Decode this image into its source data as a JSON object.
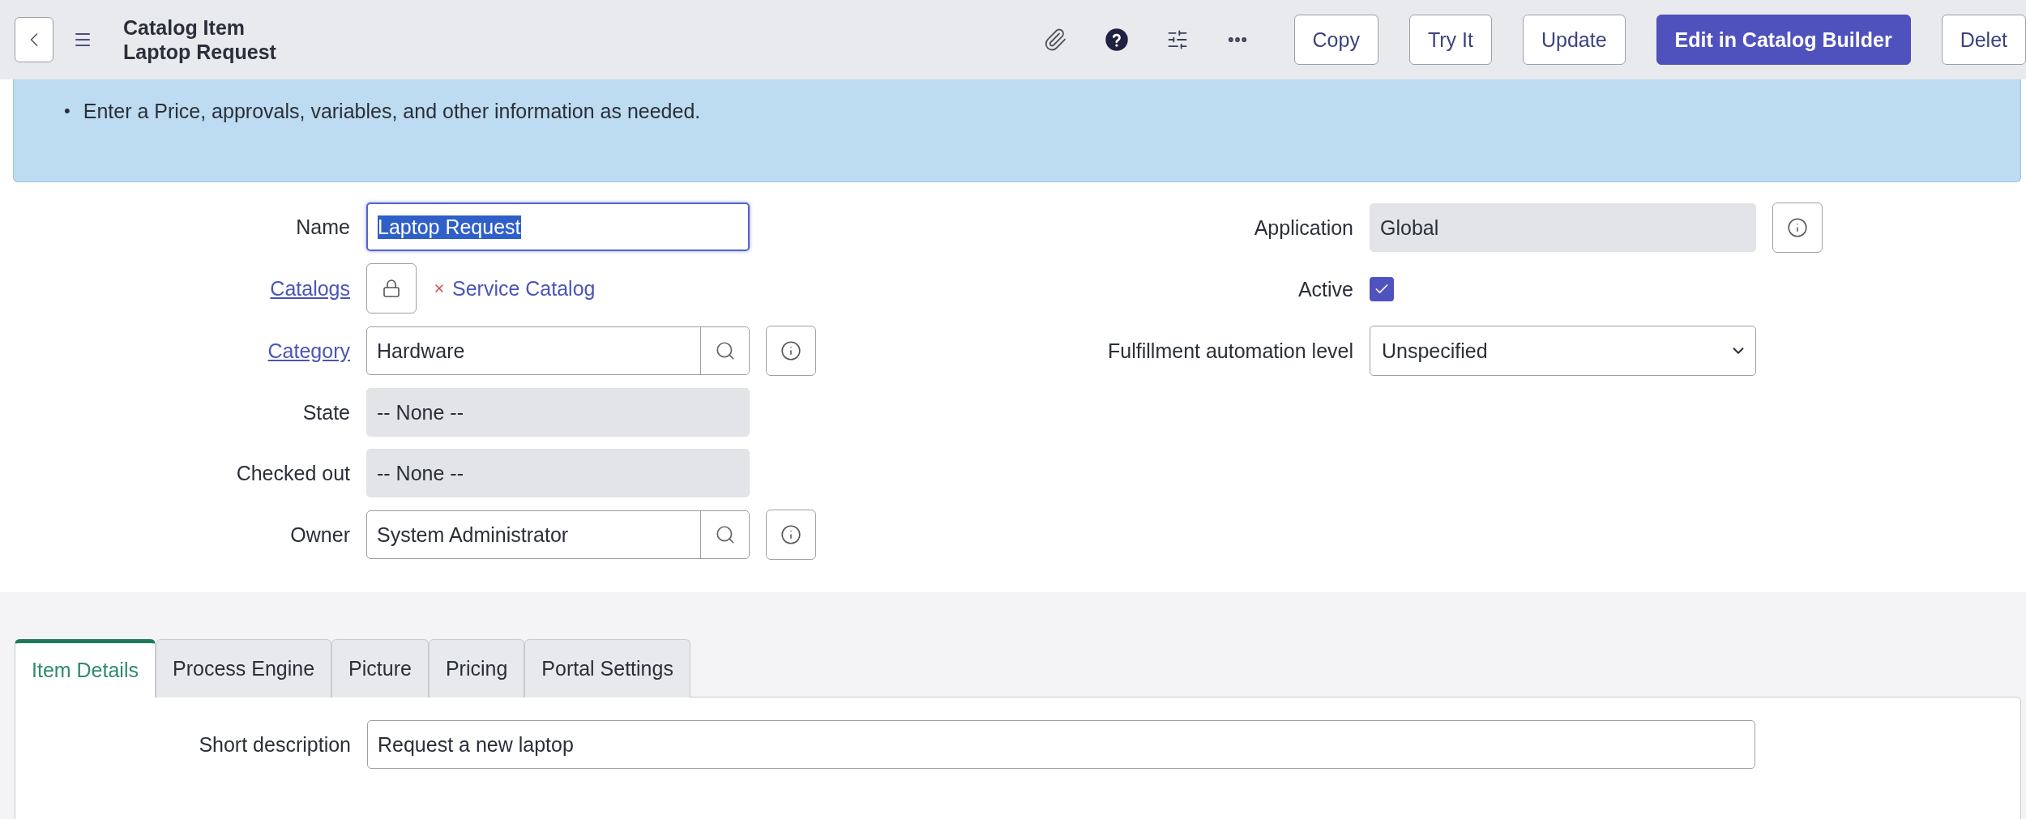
{
  "header": {
    "title": "Catalog Item",
    "subtitle": "Laptop Request",
    "buttons": [
      {
        "label": "Copy",
        "kind": "secondary"
      },
      {
        "label": "Try It",
        "kind": "secondary"
      },
      {
        "label": "Update",
        "kind": "secondary"
      },
      {
        "label": "Edit in Catalog Builder",
        "kind": "primary"
      },
      {
        "label": "Delet",
        "kind": "secondary"
      }
    ]
  },
  "banner": {
    "bullets": [
      {
        "marker": "•",
        "text": "Enter a Price, approvals, variables, and other information as needed."
      }
    ]
  },
  "form": {
    "left_fields": [
      {
        "label": "Name",
        "link": false,
        "kind": "text",
        "value": "Laptop Request",
        "text_selected": true
      },
      {
        "label": "Catalogs",
        "link": true,
        "kind": "tags",
        "tags": [
          "Service Catalog"
        ]
      },
      {
        "label": "Category",
        "link": true,
        "kind": "lookup",
        "value": "Hardware",
        "info_button": true
      },
      {
        "label": "State",
        "link": false,
        "kind": "readonly",
        "value": "-- None --"
      },
      {
        "label": "Checked out",
        "link": false,
        "kind": "readonly",
        "value": "-- None --"
      },
      {
        "label": "Owner",
        "link": false,
        "kind": "lookup",
        "value": "System Administrator",
        "info_button": true
      }
    ],
    "right_fields": [
      {
        "label": "Application",
        "kind": "readonly",
        "value": "Global",
        "info_button": true
      },
      {
        "label": "Active",
        "kind": "checkbox",
        "checked": true
      },
      {
        "label": "Fulfillment automation level",
        "kind": "select",
        "value": "Unspecified"
      }
    ]
  },
  "tabs": [
    {
      "label": "Item Details",
      "selected": true
    },
    {
      "label": "Process Engine",
      "selected": false
    },
    {
      "label": "Picture",
      "selected": false
    },
    {
      "label": "Pricing",
      "selected": false
    },
    {
      "label": "Portal Settings",
      "selected": false
    }
  ],
  "tab_panel": {
    "fields": [
      {
        "label": "Short description",
        "value": "Request a new laptop"
      }
    ]
  }
}
